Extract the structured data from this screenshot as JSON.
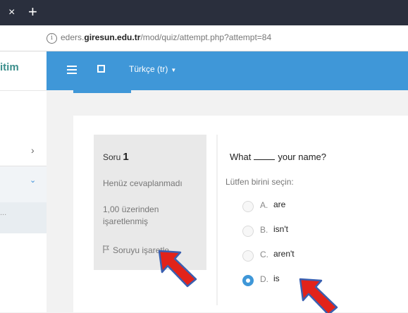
{
  "browser": {
    "tab_close_glyph": "×",
    "new_tab_glyph": "+",
    "url_prefix": "eders.",
    "url_domain": "giresun.edu.tr",
    "url_path": "/mod/quiz/attempt.php?attempt=84"
  },
  "sidebar": {
    "brand_text": "itim",
    "item1_chevron": "›",
    "item2_chevron": "⌄",
    "item3_text": "..."
  },
  "navbar": {
    "language": "Türkçe (tr)",
    "caret": "▼"
  },
  "question_info": {
    "label": "Soru",
    "number": "1",
    "state": "Henüz cevaplanmadı",
    "grade_line1": "1,00 üzerinden",
    "grade_line2": "işaretlenmiş",
    "flag_label": "Soruyu işaretle"
  },
  "question": {
    "text_before": "What",
    "text_after": "your name?",
    "prompt": "Lütfen birini seçin:",
    "options": [
      {
        "letter": "A.",
        "text": "are",
        "checked": false
      },
      {
        "letter": "B.",
        "text": "isn't",
        "checked": false
      },
      {
        "letter": "C.",
        "text": "aren't",
        "checked": false
      },
      {
        "letter": "D.",
        "text": "is",
        "checked": true
      }
    ]
  },
  "colors": {
    "navbar": "#3f97d8",
    "annotation_arrow_fill": "#e2231a",
    "annotation_arrow_stroke": "#3a5fb0"
  }
}
